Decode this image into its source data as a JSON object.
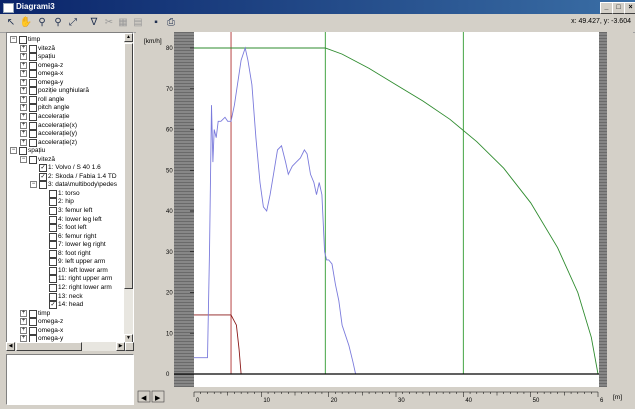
{
  "window": {
    "title": "Diagrami3"
  },
  "toolbar": {
    "tools": [
      "arrow-icon",
      "hand-icon",
      "zoom-icon",
      "zoom-minus-icon",
      "fit-icon",
      "filter-icon",
      "cut-icon",
      "table-icon",
      "grid-icon",
      "save-icon",
      "print-icon"
    ],
    "coords": "x: 49.427, y: -3.604"
  },
  "tree": {
    "items": [
      {
        "label": "timp",
        "level": 0,
        "expander": "−",
        "checked": false
      },
      {
        "label": "viteză",
        "level": 1,
        "expander": "+",
        "checked": false
      },
      {
        "label": "spațiu",
        "level": 1,
        "expander": "+",
        "checked": false
      },
      {
        "label": "omega-z",
        "level": 1,
        "expander": "+",
        "checked": false
      },
      {
        "label": "omega-x",
        "level": 1,
        "expander": "+",
        "checked": false
      },
      {
        "label": "omega-y",
        "level": 1,
        "expander": "+",
        "checked": false
      },
      {
        "label": "poziție unghiulară",
        "level": 1,
        "expander": "+",
        "checked": false
      },
      {
        "label": "roll angle",
        "level": 1,
        "expander": "+",
        "checked": false
      },
      {
        "label": "pitch angle",
        "level": 1,
        "expander": "+",
        "checked": false
      },
      {
        "label": "accelerație",
        "level": 1,
        "expander": "+",
        "checked": false
      },
      {
        "label": "accelerație(x)",
        "level": 1,
        "expander": "+",
        "checked": false
      },
      {
        "label": "accelerație(y)",
        "level": 1,
        "expander": "+",
        "checked": false
      },
      {
        "label": "accelerație(z)",
        "level": 1,
        "expander": "+",
        "checked": false
      },
      {
        "label": "spațiu",
        "level": 0,
        "expander": "−",
        "checked": false
      },
      {
        "label": "viteză",
        "level": 1,
        "expander": "−",
        "checked": false
      },
      {
        "label": "1: Volvo / S 40 1.6",
        "level": 2,
        "expander": "",
        "checked": true
      },
      {
        "label": "2: Skoda / Fabia 1.4 TD",
        "level": 2,
        "expander": "",
        "checked": true
      },
      {
        "label": "3: data\\multibody\\pedes",
        "level": 2,
        "expander": "−",
        "checked": false
      },
      {
        "label": "1: torso",
        "level": 3,
        "expander": "",
        "checked": false
      },
      {
        "label": "2: hip",
        "level": 3,
        "expander": "",
        "checked": false
      },
      {
        "label": "3: femur left",
        "level": 3,
        "expander": "",
        "checked": false
      },
      {
        "label": "4: lower leg left",
        "level": 3,
        "expander": "",
        "checked": false
      },
      {
        "label": "5: foot left",
        "level": 3,
        "expander": "",
        "checked": false
      },
      {
        "label": "6: femur right",
        "level": 3,
        "expander": "",
        "checked": false
      },
      {
        "label": "7: lower leg right",
        "level": 3,
        "expander": "",
        "checked": false
      },
      {
        "label": "8: foot right",
        "level": 3,
        "expander": "",
        "checked": false
      },
      {
        "label": "9: left upper arm",
        "level": 3,
        "expander": "",
        "checked": false
      },
      {
        "label": "10: left lower arm",
        "level": 3,
        "expander": "",
        "checked": false
      },
      {
        "label": "11: right upper arm",
        "level": 3,
        "expander": "",
        "checked": false
      },
      {
        "label": "12: right lower arm",
        "level": 3,
        "expander": "",
        "checked": false
      },
      {
        "label": "13: neck",
        "level": 3,
        "expander": "",
        "checked": false
      },
      {
        "label": "14: head",
        "level": 3,
        "expander": "",
        "checked": true
      },
      {
        "label": "timp",
        "level": 1,
        "expander": "+",
        "checked": false
      },
      {
        "label": "omega-z",
        "level": 1,
        "expander": "+",
        "checked": false
      },
      {
        "label": "omega-x",
        "level": 1,
        "expander": "+",
        "checked": false
      },
      {
        "label": "omega-y",
        "level": 1,
        "expander": "+",
        "checked": false
      }
    ]
  },
  "chart_data": {
    "type": "line",
    "ylabel": "[km/h]",
    "xlabel": "[m]",
    "xlim": [
      0,
      60
    ],
    "ylim": [
      0,
      80
    ],
    "xticks": [
      "0",
      "10",
      "20",
      "30",
      "40",
      "50",
      "6"
    ],
    "yticks": [
      "0",
      "10",
      "20",
      "30",
      "40",
      "50",
      "60",
      "70",
      "80"
    ],
    "colors": {
      "series1": "#2e8b2e",
      "series2": "#8b1a1a",
      "series3": "#7b7bdc",
      "axis": "#000000"
    },
    "series": [
      {
        "x": [
          0,
          19.5,
          22,
          26,
          30,
          34,
          38,
          42,
          46,
          50,
          54,
          57,
          59,
          60
        ],
        "y": [
          80,
          80,
          78.5,
          75,
          71,
          67,
          62.5,
          57,
          50.5,
          42,
          31,
          20,
          9,
          0
        ]
      },
      {
        "x": [
          0,
          5.5,
          6.3,
          6.7,
          7
        ],
        "y": [
          14.5,
          14.5,
          12,
          6,
          0
        ]
      },
      {
        "x": [
          0,
          2,
          2.3,
          2.6,
          2.8,
          3,
          3.3,
          3.6,
          4,
          4.6,
          5,
          5.5,
          6,
          7,
          7.6,
          8,
          8.6,
          9.2,
          9.8,
          10.3,
          10.8,
          11.3,
          11.8,
          12.4,
          13,
          13.6,
          14,
          14.6,
          15.2,
          15.8,
          16.4,
          16.8,
          17.3,
          17.8,
          18.2,
          18.6,
          19,
          19.4,
          19.7,
          20,
          20.5,
          21,
          21.5,
          22,
          23,
          23.6,
          24
        ],
        "y": [
          4,
          4,
          30,
          66,
          52,
          60,
          58,
          62,
          62,
          63,
          62,
          62,
          66,
          77,
          80,
          77,
          71,
          58,
          47,
          41,
          40,
          44,
          49,
          55,
          56,
          52,
          49,
          51,
          52,
          53,
          55,
          54,
          49,
          47,
          44,
          47,
          44,
          30,
          28,
          28,
          27,
          22,
          18,
          12,
          7,
          3,
          0
        ]
      }
    ],
    "verticals": [
      {
        "x": 5.5,
        "color": "#b03030"
      },
      {
        "x": 19.5,
        "color": "#2e9a2e"
      },
      {
        "x": 40,
        "color": "#2e9a2e"
      }
    ]
  }
}
